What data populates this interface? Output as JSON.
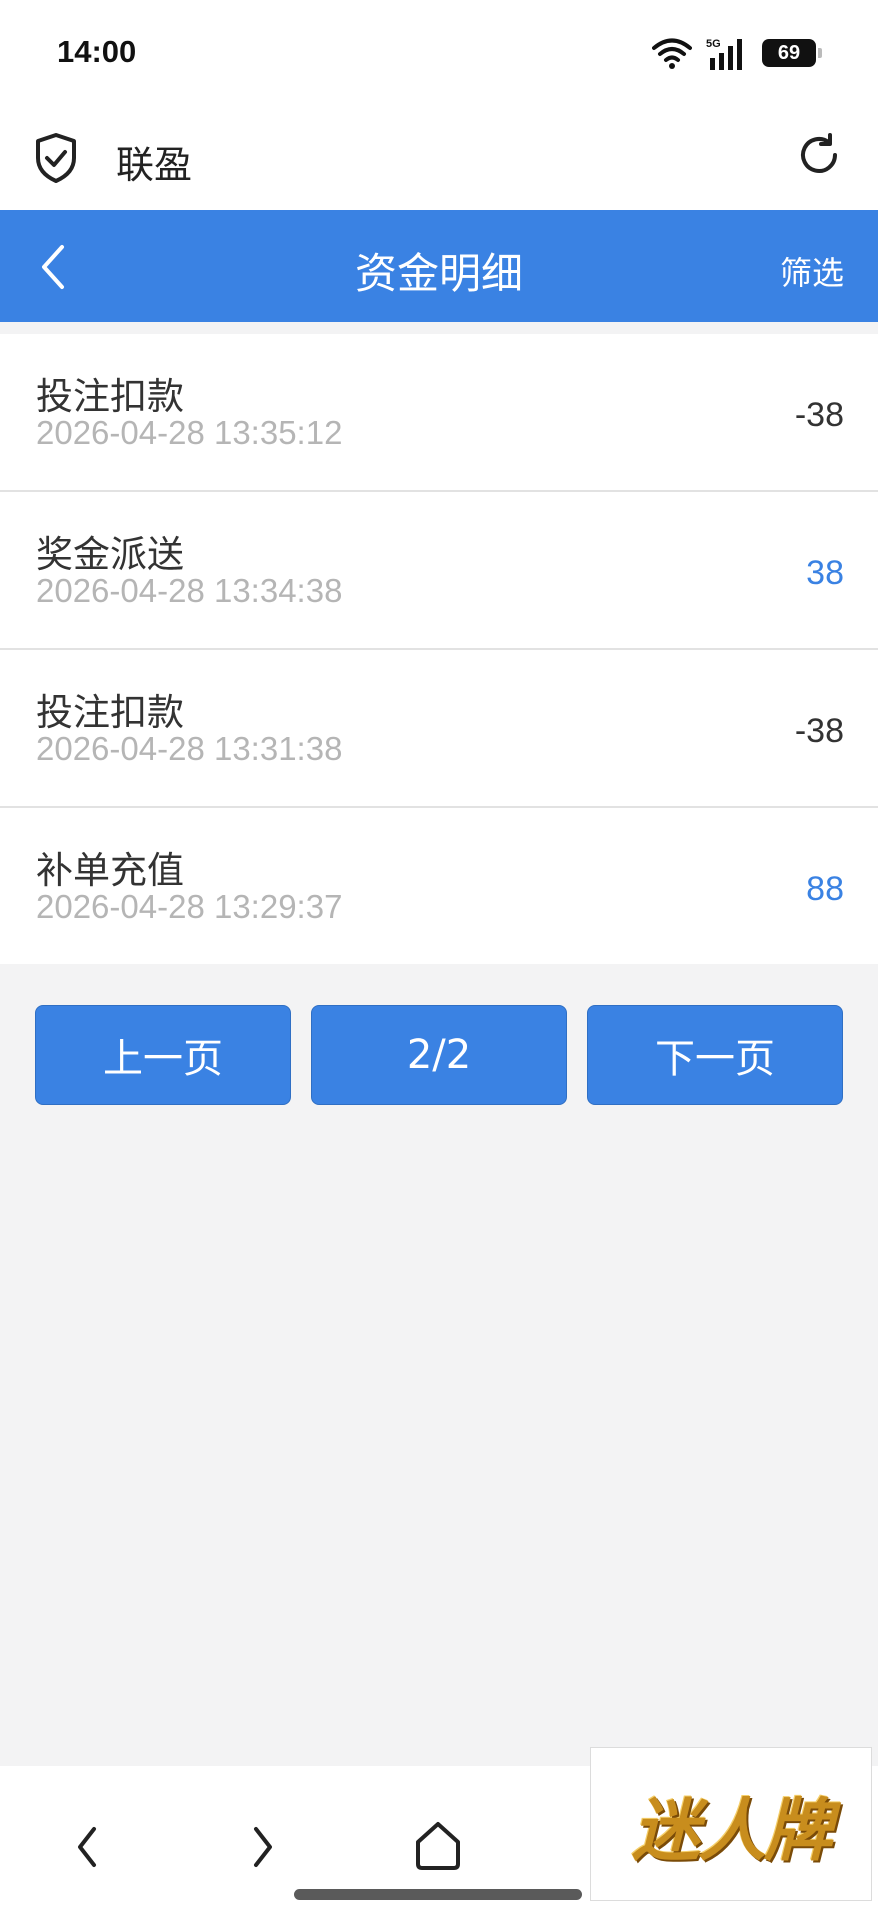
{
  "status_bar": {
    "time": "14:00",
    "network": "5G",
    "battery": "69"
  },
  "app_header": {
    "app_name": "联盈",
    "icons": [
      "shield-check-icon",
      "refresh-icon"
    ]
  },
  "title_bar": {
    "title": "资金明细",
    "filter_label": "筛选"
  },
  "records": [
    {
      "title": "投注扣款",
      "time": "2026-04-28 13:35:12",
      "amount": "-38",
      "sign": "negative"
    },
    {
      "title": "奖金派送",
      "time": "2026-04-28 13:34:38",
      "amount": "38",
      "sign": "positive"
    },
    {
      "title": "投注扣款",
      "time": "2026-04-28 13:31:38",
      "amount": "-38",
      "sign": "negative"
    },
    {
      "title": "补单充值",
      "time": "2026-04-28 13:29:37",
      "amount": "88",
      "sign": "positive"
    }
  ],
  "pagination": {
    "prev_label": "上一页",
    "page_indicator": "2/2",
    "next_label": "下一页"
  },
  "watermark": {
    "text": "迷人牌"
  },
  "colors": {
    "primary": "#3a82e3",
    "positive_amount": "#3a82e3",
    "negative_amount": "#333333",
    "background": "#f3f3f4"
  }
}
